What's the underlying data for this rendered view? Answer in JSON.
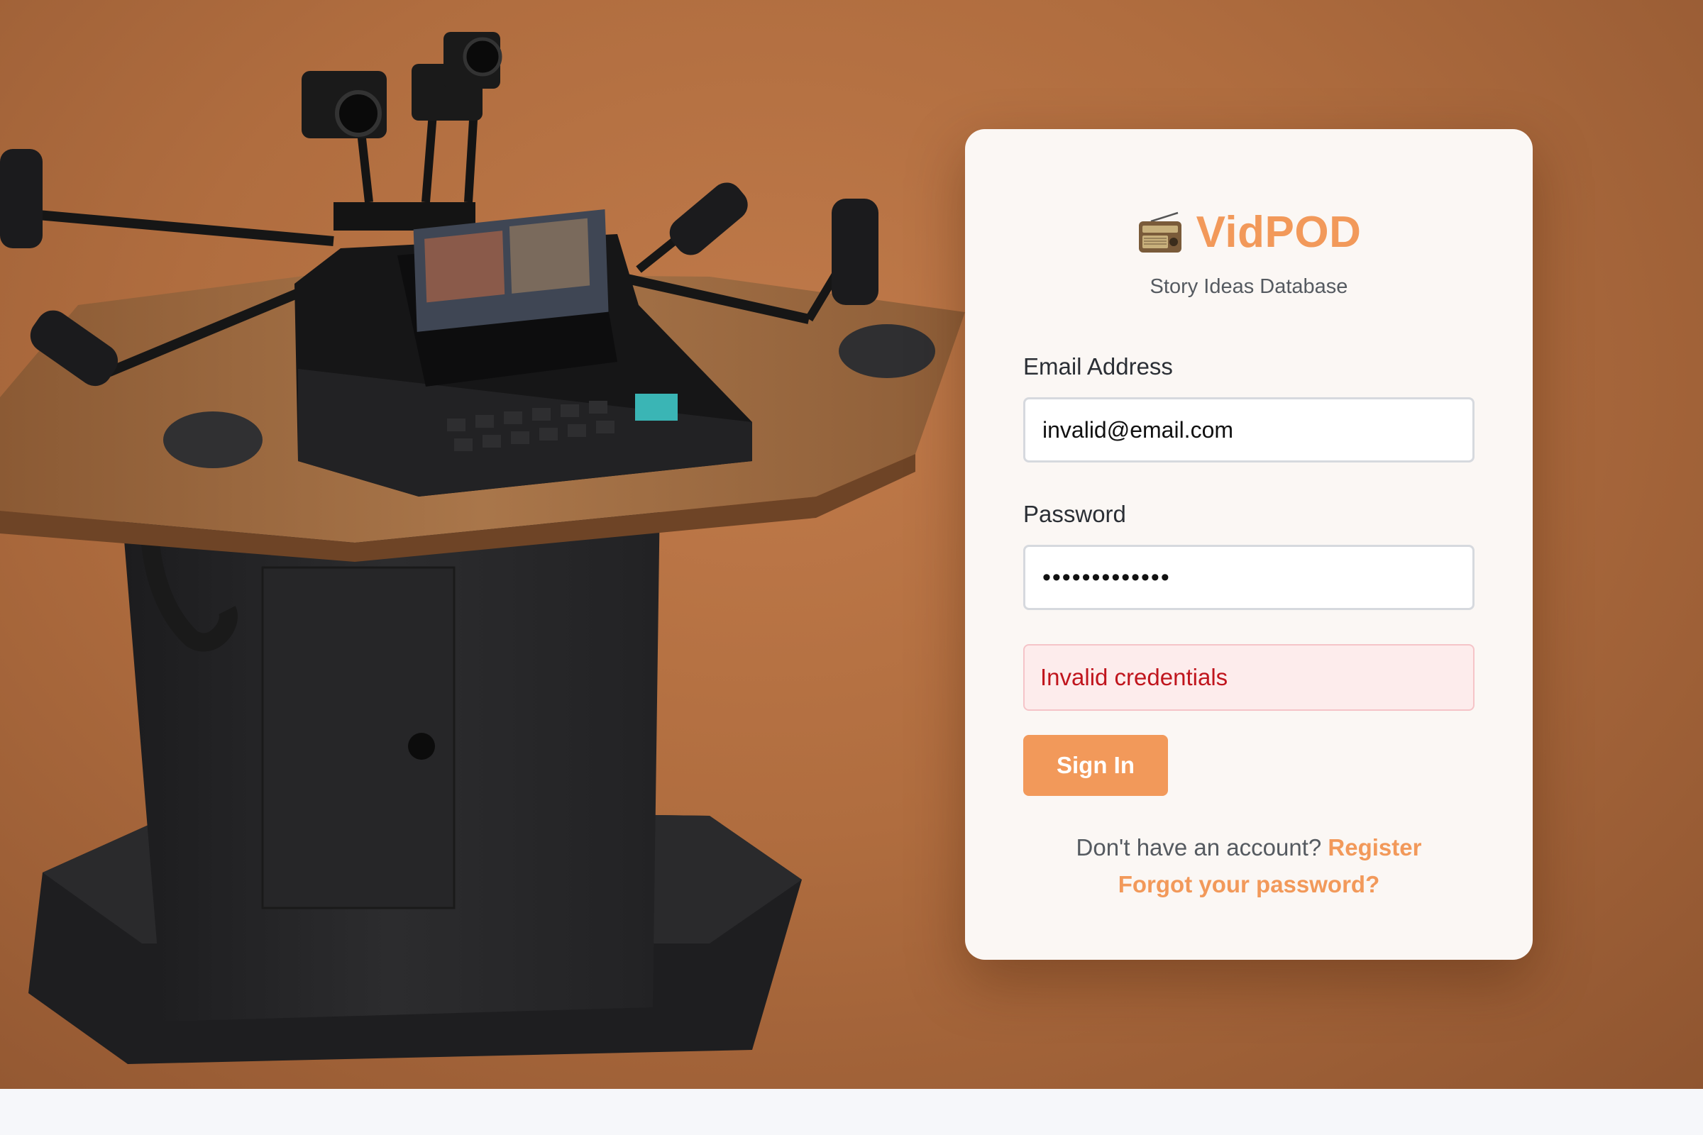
{
  "app": {
    "title": "VidPOD",
    "subtitle": "Story Ideas Database",
    "icon": "radio-icon",
    "accent_color": "#f2995a"
  },
  "hero": {
    "background_color": "#b06d3f",
    "image": "podcast-studio-table-illustration"
  },
  "form": {
    "email_label": "Email Address",
    "email_value": "invalid@email.com",
    "password_label": "Password",
    "password_value": "•••••••••••••",
    "error_message": "Invalid credentials",
    "error_color": "#c0151d",
    "submit_label": "Sign In"
  },
  "links": {
    "register_prompt": "Don't have an account?",
    "register_label": "Register",
    "forgot_label": "Forgot your password?"
  }
}
